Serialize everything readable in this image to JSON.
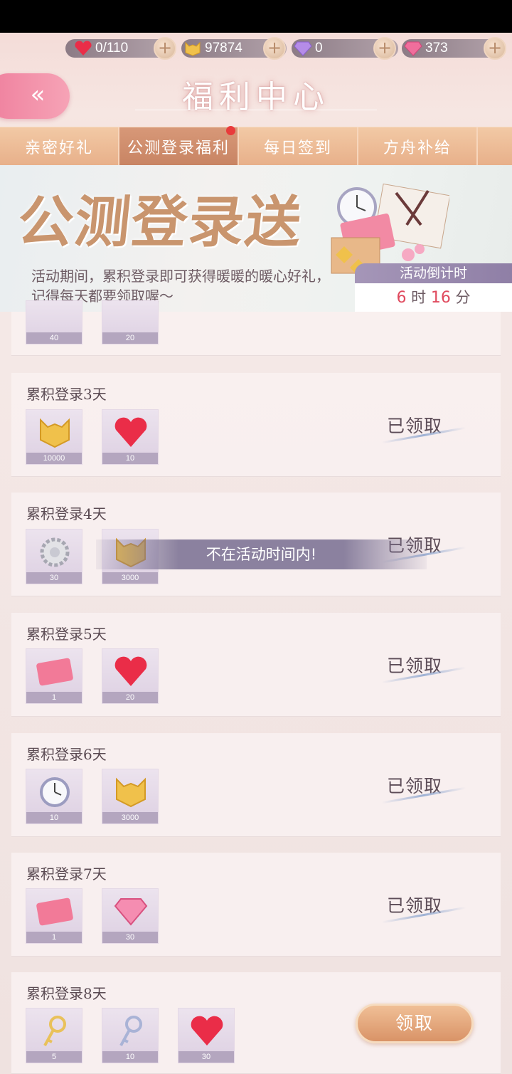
{
  "resources": {
    "stamina": "0/110",
    "coins": "97874",
    "diamonds_purple": "0",
    "diamonds_pink": "373"
  },
  "title": "福利中心",
  "tabs": [
    "亲密好礼",
    "公测登录福利",
    "每日签到",
    "方舟补给"
  ],
  "banner": {
    "title": "公测登录送",
    "desc_line1": "活动期间，累积登录即可获得暖暖的暖心好礼，",
    "desc_line2": "记得每天都要领取喔～",
    "countdown_label": "活动倒计时",
    "countdown_hours": "6",
    "countdown_hours_unit": "时",
    "countdown_minutes": "16",
    "countdown_minutes_unit": "分"
  },
  "partial_row": {
    "counts": [
      "40",
      "20"
    ]
  },
  "rows": [
    {
      "title": "累积登录3天",
      "items": [
        {
          "icon": "coin-icon",
          "count": "10000"
        },
        {
          "icon": "heart-icon",
          "count": "10"
        }
      ],
      "status": "已领取"
    },
    {
      "title": "累积登录4天",
      "items": [
        {
          "icon": "gear-icon",
          "count": "30"
        },
        {
          "icon": "coin-icon",
          "count": "3000"
        }
      ],
      "status": "已领取"
    },
    {
      "title": "累积登录5天",
      "items": [
        {
          "icon": "card-icon",
          "count": "1"
        },
        {
          "icon": "heart-icon",
          "count": "20"
        }
      ],
      "status": "已领取"
    },
    {
      "title": "累积登录6天",
      "items": [
        {
          "icon": "clock-icon",
          "count": "10"
        },
        {
          "icon": "coin-icon",
          "count": "3000"
        }
      ],
      "status": "已领取"
    },
    {
      "title": "累积登录7天",
      "items": [
        {
          "icon": "card-icon",
          "count": "1"
        },
        {
          "icon": "diamond-icon",
          "count": "30"
        }
      ],
      "status": "已领取"
    },
    {
      "title": "累积登录8天",
      "items": [
        {
          "icon": "gold-key-icon",
          "count": "5"
        },
        {
          "icon": "silver-key-icon",
          "count": "10"
        },
        {
          "icon": "heart-icon",
          "count": "30"
        }
      ],
      "status": "领取"
    }
  ],
  "toast": "不在活动时间内!",
  "colors": {
    "accent_pink": "#ef7f9d",
    "tab_orange": "#e8b08a",
    "countdown_red": "#e04a5e"
  }
}
